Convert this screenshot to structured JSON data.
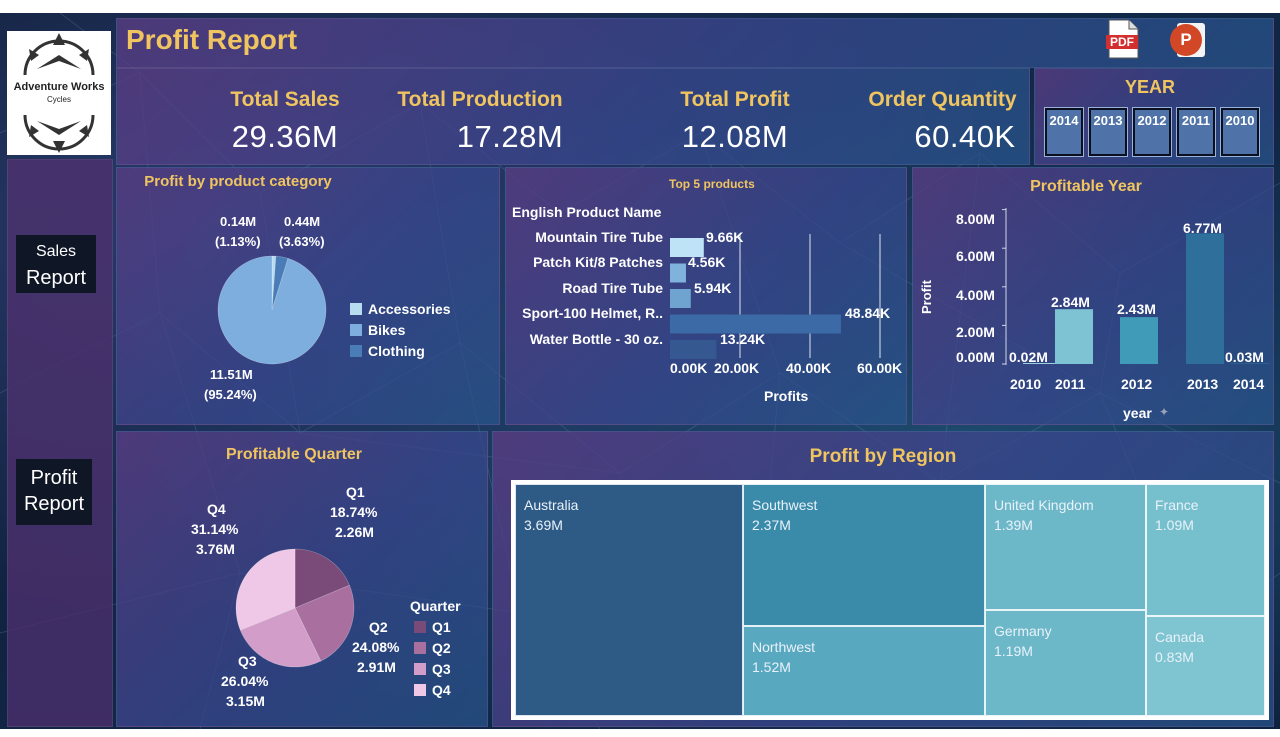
{
  "header": {
    "title": "Profit Report",
    "logo_text_line1": "Adventure Works",
    "logo_text_line2": "Cycles",
    "pdf_label": "PDF",
    "ppt_label": "P"
  },
  "kpis": [
    {
      "label": "Total Sales",
      "value": "29.36M"
    },
    {
      "label": "Total Production",
      "value": "17.28M"
    },
    {
      "label": "Total Profit",
      "value": "12.08M"
    },
    {
      "label": "Order Quantity",
      "value": "60.40K"
    }
  ],
  "year_filter": {
    "title": "YEAR",
    "years": [
      "2014",
      "2013",
      "2012",
      "2011",
      "2010"
    ]
  },
  "nav": {
    "sales_line1": "Sales",
    "sales_line2": "Report",
    "profit_line1": "Profit",
    "profit_line2": "Report"
  },
  "category_chart": {
    "title": "Profit by product category",
    "slices": [
      {
        "name": "Accessories",
        "value_label": "0.14M",
        "pct_label": "(1.13%)",
        "value": 0.14,
        "color": "#b7dcf0"
      },
      {
        "name": "Bikes",
        "value_label": "11.51M",
        "pct_label": "(95.24%)",
        "value": 11.51,
        "color": "#7eaede"
      },
      {
        "name": "Clothing",
        "value_label": "0.44M",
        "pct_label": "(3.63%)",
        "value": 0.44,
        "color": "#4a7cb8"
      }
    ]
  },
  "top_products": {
    "title": "Top 5 products",
    "header": "English Product Name",
    "xlabel": "Profits",
    "ticks": [
      "0.00K",
      "20.00K",
      "40.00K",
      "60.00K"
    ],
    "tick_values": [
      0,
      20,
      40,
      60
    ],
    "items": [
      {
        "name": "Mountain Tire Tube",
        "value": 9.66,
        "label": "9.66K",
        "color": "#bfe3f6"
      },
      {
        "name": "Patch Kit/8 Patches",
        "value": 4.56,
        "label": "4.56K",
        "color": "#7fb3dc"
      },
      {
        "name": "Road Tire Tube",
        "value": 5.94,
        "label": "5.94K",
        "color": "#6fa3d0"
      },
      {
        "name": "Sport-100 Helmet, R..",
        "value": 48.84,
        "label": "48.84K",
        "color": "#3c6aa6"
      },
      {
        "name": "Water Bottle - 30 oz.",
        "value": 13.24,
        "label": "13.24K",
        "color": "#34588f"
      }
    ]
  },
  "profitable_year": {
    "title": "Profitable Year",
    "ylabel": "Profit",
    "xlabel": "year",
    "yticks": [
      "8.00M",
      "6.00M",
      "4.00M",
      "2.00M",
      "0.00M"
    ],
    "ytick_values": [
      8,
      6,
      4,
      2,
      0
    ],
    "bars": [
      {
        "year": "2010",
        "value": 0.02,
        "label": "0.02M",
        "color": "#9ad0dc"
      },
      {
        "year": "2011",
        "value": 2.84,
        "label": "2.84M",
        "color": "#7ec3d3"
      },
      {
        "year": "2012",
        "value": 2.43,
        "label": "2.43M",
        "color": "#3f9bb8"
      },
      {
        "year": "2013",
        "value": 6.77,
        "label": "6.77M",
        "color": "#2e6f9c"
      },
      {
        "year": "2014",
        "value": 0.03,
        "label": "0.03M",
        "color": "#2a5f8f"
      }
    ]
  },
  "quarter_chart": {
    "title": "Profitable Quarter",
    "legend_title": "Quarter",
    "slices": [
      {
        "name": "Q1",
        "pct": "18.74%",
        "value_label": "2.26M",
        "value": 2.26,
        "color": "#7a4a78"
      },
      {
        "name": "Q2",
        "pct": "24.08%",
        "value_label": "2.91M",
        "value": 2.91,
        "color": "#a9709f"
      },
      {
        "name": "Q3",
        "pct": "26.04%",
        "value_label": "3.15M",
        "value": 3.15,
        "color": "#d29ec9"
      },
      {
        "name": "Q4",
        "pct": "31.14%",
        "value_label": "3.76M",
        "value": 3.76,
        "color": "#eec8e6"
      }
    ]
  },
  "region_chart": {
    "title": "Profit by Region",
    "regions": [
      {
        "name": "Australia",
        "value": "3.69M",
        "color": "#2e5a86"
      },
      {
        "name": "Southwest",
        "value": "2.37M",
        "color": "#3a8aaa"
      },
      {
        "name": "Northwest",
        "value": "1.52M",
        "color": "#58a8c0"
      },
      {
        "name": "United Kingdom",
        "value": "1.39M",
        "color": "#6cb7c8"
      },
      {
        "name": "Germany",
        "value": "1.19M",
        "color": "#6cb7c8"
      },
      {
        "name": "France",
        "value": "1.09M",
        "color": "#76bfcd"
      },
      {
        "name": "Canada",
        "value": "0.83M",
        "color": "#7ec4d1"
      }
    ]
  },
  "colors": {
    "accent_gold": "#f0c560",
    "nav_button": "#0f1626",
    "year_button": "#4f73a8"
  }
}
